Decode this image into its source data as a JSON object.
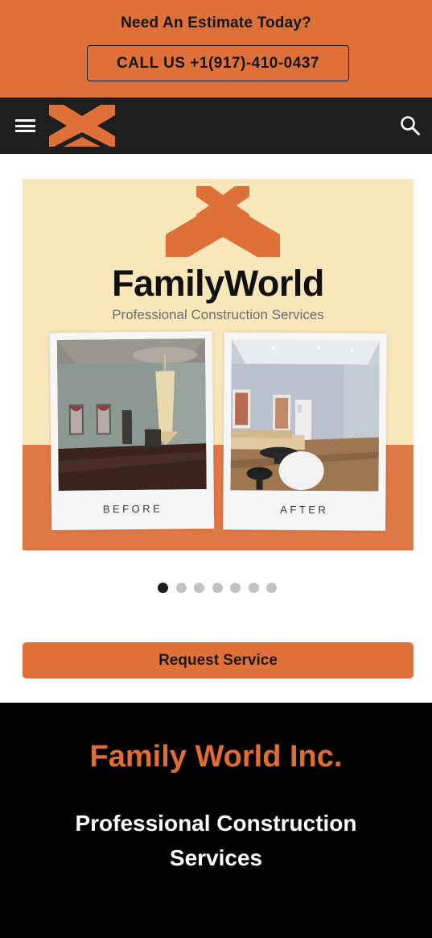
{
  "topbar": {
    "estimate_text": "Need An Estimate Today?",
    "call_button": "CALL US +1(917)-410-0437"
  },
  "navbar": {
    "menu_icon": "hamburger-menu-icon",
    "logo": "family-world-roof-logo",
    "search_icon": "search-icon"
  },
  "hero": {
    "brand_name": "FamilyWorld",
    "brand_tagline": "Professional Construction Services",
    "before_label": "BEFORE",
    "after_label": "AFTER"
  },
  "carousel": {
    "slide_count": 7,
    "active_index": 0
  },
  "cta": {
    "request_label": "Request Service"
  },
  "footer": {
    "company_name": "Family World Inc.",
    "company_tagline": "Professional Construction Services"
  },
  "colors": {
    "accent": "#e07039",
    "nav_bg": "#1e1e1e",
    "hero_cream": "#fae6bb",
    "footer_bg": "#000000"
  }
}
